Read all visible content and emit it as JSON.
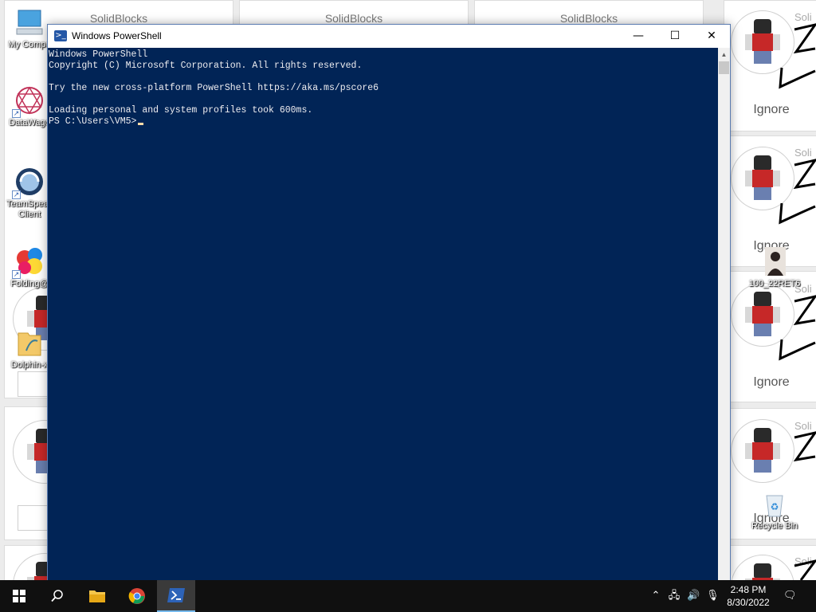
{
  "wallpaper": {
    "tile_titles": [
      "SolidBlocks",
      "SolidBlocks",
      "SolidBlocks"
    ],
    "ignore_labels": [
      "Ignore",
      "Ignore",
      "Ignore",
      "Ignore"
    ],
    "right_titles": [
      "Soli",
      "Soli",
      "Soli",
      "Soli",
      "Soli"
    ]
  },
  "desktop_icons": [
    {
      "label": "My Compu",
      "icon": "computer-icon"
    },
    {
      "label": "DataWago",
      "icon": "datawagon-icon"
    },
    {
      "label": "TeamSpeak",
      "label2": "Client",
      "icon": "teamspeak-icon"
    },
    {
      "label": "Folding@",
      "icon": "folding-at-home-icon"
    },
    {
      "label": "Dolphin-x",
      "icon": "dolphin-folder-icon"
    },
    {
      "label": "100_22RET6",
      "icon": "photo-icon"
    },
    {
      "label": "Recycle Bin",
      "icon": "recycle-bin-icon"
    }
  ],
  "window": {
    "title": "Windows PowerShell",
    "controls": {
      "minimize": "—",
      "maximize": "☐",
      "close": "✕"
    },
    "console_lines": [
      "Windows PowerShell",
      "Copyright (C) Microsoft Corporation. All rights reserved.",
      "",
      "Try the new cross-platform PowerShell https://aka.ms/pscore6",
      "",
      "Loading personal and system profiles took 600ms."
    ],
    "prompt": "PS C:\\Users\\VM5>"
  },
  "taskbar": {
    "items": [
      "start-icon",
      "search-icon",
      "file-explorer-icon",
      "chrome-icon",
      "powershell-icon"
    ],
    "active": "powershell-icon",
    "clock_time": "2:48 PM",
    "clock_date": "8/30/2022"
  },
  "colors": {
    "console_bg": "#012456",
    "console_text": "#eeedf0",
    "taskbar_bg": "#101010",
    "accent": "#76b9ed"
  }
}
